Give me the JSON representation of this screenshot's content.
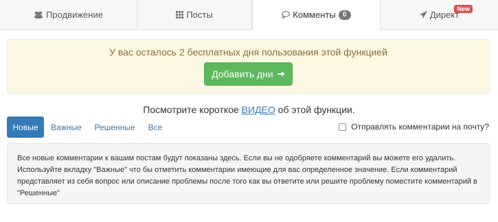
{
  "tabs": [
    {
      "label": "Продвижение",
      "icon": "users-icon"
    },
    {
      "label": "Посты",
      "icon": "grid-icon"
    },
    {
      "label": "Комменты",
      "icon": "comment-icon",
      "count": "0"
    },
    {
      "label": "Директ",
      "icon": "send-icon",
      "badge": "New"
    }
  ],
  "alert": {
    "message": "У вас осталось 2 бесплатных дня пользования этой функцией",
    "button_label": "Добавить дни",
    "button_icon": "arrow-right-icon"
  },
  "video": {
    "before": "Посмотрите короткое ",
    "link": "ВИДЕО",
    "after": " об этой функции."
  },
  "filters": [
    {
      "label": "Новые"
    },
    {
      "label": "Важные"
    },
    {
      "label": "Решенные"
    },
    {
      "label": "Все"
    }
  ],
  "email_option": {
    "label": "Отправлять комментарии на почту?",
    "checked": false
  },
  "info_text": "Все новые комментарии к вашим постам будут показаны здесь. Если вы не одобряете комментарий вы можете его удалить. Используйте вкладку \"Важные\" что бы отметить комментарии имеющие для вас определенное значение. Если комментарий представляет из себя вопрос или описание проблемы после того как вы ответите или решите проблему поместите комментарий в \"Решенные\"",
  "colors": {
    "primary": "#337ab7",
    "success": "#5cb85c",
    "warning_bg": "#fcf8e3",
    "warning_text": "#8a6d3b",
    "danger": "#d9534f"
  }
}
